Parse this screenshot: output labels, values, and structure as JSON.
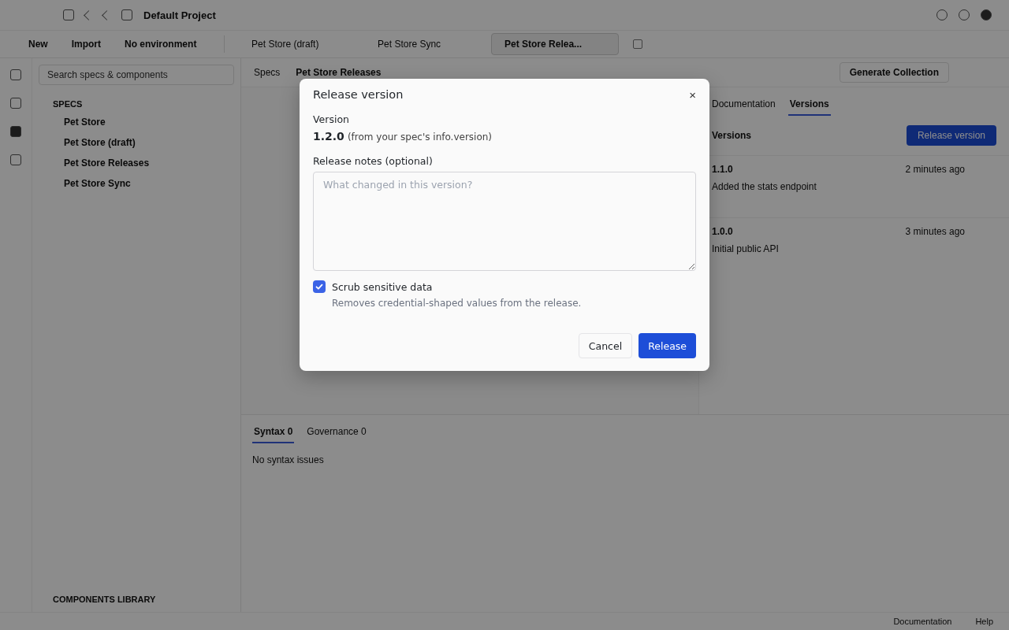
{
  "top_bar": {
    "project": "Default Project"
  },
  "toolbar": {
    "new": "New",
    "import": "Import",
    "environment": "No environment"
  },
  "tabs": [
    {
      "label": "Pet Store (draft)",
      "selected": false
    },
    {
      "label": "Pet Store Sync",
      "selected": false
    },
    {
      "label": "Pet Store Relea...",
      "selected": true
    }
  ],
  "sidebar": {
    "search_placeholder": "Search specs & components",
    "section": "SPECS",
    "items": [
      "Pet Store",
      "Pet Store (draft)",
      "Pet Store Releases",
      "Pet Store Sync"
    ],
    "footer_section": "COMPONENTS LIBRARY"
  },
  "breadcrumb": {
    "root": "Specs",
    "current": "Pet Store Releases"
  },
  "actions": {
    "generate": "Generate Collection"
  },
  "right_panel": {
    "tabs": [
      {
        "label": "Documentation",
        "selected": false
      },
      {
        "label": "Versions",
        "selected": true
      }
    ],
    "heading": "Versions",
    "release_button": "Release version",
    "versions": [
      {
        "version": "1.1.0",
        "time": "2 minutes ago",
        "note": "Added the stats endpoint"
      },
      {
        "version": "1.0.0",
        "time": "3 minutes ago",
        "note": "Initial public API"
      }
    ]
  },
  "bottom_panel": {
    "tabs": [
      {
        "label": "Syntax 0",
        "selected": true
      },
      {
        "label": "Governance 0",
        "selected": false
      }
    ],
    "message": "No syntax issues"
  },
  "status_bar": {
    "documentation": "Documentation",
    "help": "Help"
  },
  "dialog": {
    "title": "Release version",
    "close": "×",
    "version_label": "Version",
    "version": "1.2.0",
    "version_source": "(from your spec's info.version)",
    "notes_label": "Release notes (optional)",
    "notes_placeholder": "What changed in this version?",
    "scrub": {
      "label": "Scrub sensitive data",
      "checked": true,
      "hint": "Removes credential-shaped values from the release."
    },
    "cancel": "Cancel",
    "confirm": "Release"
  }
}
